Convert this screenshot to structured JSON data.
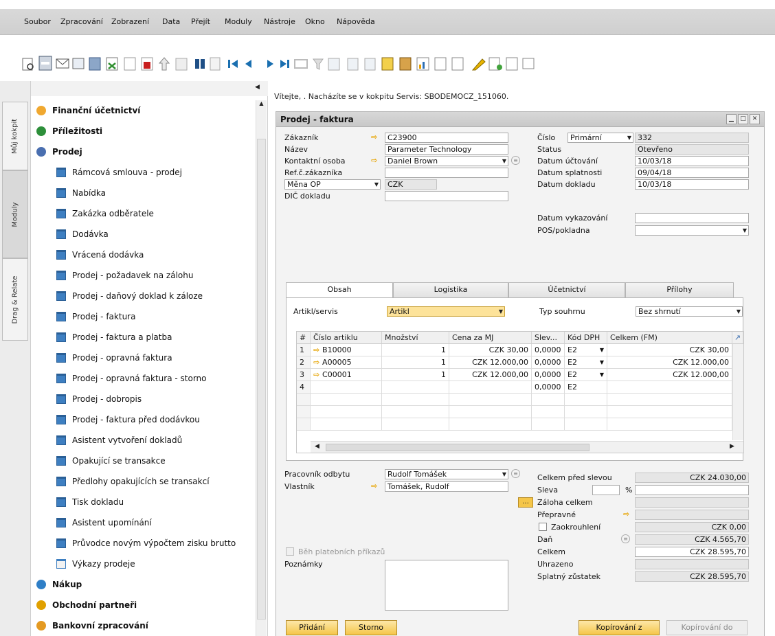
{
  "menu": [
    "Soubor",
    "Zpracování",
    "Zobrazení",
    "Data",
    "Přejít",
    "Moduly",
    "Nástroje",
    "Okno",
    "Nápověda"
  ],
  "side_tabs": [
    "Můj kokpit",
    "Moduly",
    "Drag & Relate"
  ],
  "modules": {
    "categories_top": [
      "Finanční účetnictví",
      "Příležitosti",
      "Prodej"
    ],
    "sales_items": [
      "Rámcová smlouva - prodej",
      "Nabídka",
      "Zakázka odběratele",
      "Dodávka",
      "Vrácená dodávka",
      "Prodej - požadavek na zálohu",
      "Prodej - daňový doklad k záloze",
      "Prodej - faktura",
      "Prodej - faktura a platba",
      "Prodej - opravná faktura",
      "Prodej - opravná faktura - storno",
      "Prodej - dobropis",
      "Prodej - faktura před dodávkou",
      "Asistent vytvoření dokladů",
      "Opakující se transakce",
      "Předlohy opakujících se transakcí",
      "Tisk dokladu",
      "Asistent upomínání",
      "Průvodce novým výpočtem zisku brutto",
      "Výkazy prodeje"
    ],
    "categories_bottom": [
      "Nákup",
      "Obchodní partneři",
      "Bankovní zpracování"
    ]
  },
  "welcome": "Vítejte, . Nacházíte se v kokpitu Servis: SBODEMOCZ_151060.",
  "form": {
    "title": "Prodej - faktura",
    "labels": {
      "customer": "Zákazník",
      "name": "Název",
      "contact": "Kontaktní osoba",
      "ref": "Ref.č.zákazníka",
      "currency": "Měna OP",
      "vat": "DIČ dokladu",
      "number": "Číslo",
      "status": "Status",
      "posting_date": "Datum účtování",
      "due_date": "Datum splatnosti",
      "doc_date": "Datum dokladu",
      "report_date": "Datum vykazování",
      "pos": "POS/pokladna"
    },
    "values": {
      "customer": "C23900",
      "name": "Parameter Technology",
      "contact": "Daniel Brown",
      "ref": "",
      "currency": "CZK",
      "vat": "",
      "series": "Primární",
      "number": "332",
      "status": "Otevřeno",
      "posting_date": "10/03/18",
      "due_date": "09/04/18",
      "doc_date": "10/03/18",
      "report_date": "",
      "pos": ""
    },
    "tabs": [
      "Obsah",
      "Logistika",
      "Účetnictví",
      "Přílohy"
    ],
    "item_type_label": "Artikl/servis",
    "item_type_value": "Artikl",
    "summary_label": "Typ souhrnu",
    "summary_value": "Bez shrnutí",
    "grid_headers": [
      "#",
      "Číslo artiklu",
      "Množství",
      "Cena za MJ",
      "Slev...",
      "Kód DPH",
      "Celkem (FM)"
    ],
    "rows": [
      {
        "n": "1",
        "item": "B10000",
        "qty": "1",
        "price": "CZK 30,00",
        "disc": "0,0000",
        "tax": "E2",
        "total": "CZK 30,00"
      },
      {
        "n": "2",
        "item": "A00005",
        "qty": "1",
        "price": "CZK 12.000,00",
        "disc": "0,0000",
        "tax": "E2",
        "total": "CZK 12.000,00"
      },
      {
        "n": "3",
        "item": "C00001",
        "qty": "1",
        "price": "CZK 12.000,00",
        "disc": "0,0000",
        "tax": "E2",
        "total": "CZK 12.000,00"
      },
      {
        "n": "4",
        "item": "",
        "qty": "",
        "price": "",
        "disc": "0,0000",
        "tax": "E2",
        "total": ""
      }
    ],
    "sales_employee_label": "Pracovník odbytu",
    "sales_employee": "Rudolf Tomášek",
    "owner_label": "Vlastník",
    "owner": "Tomášek, Rudolf",
    "payment_run_label": "Běh platebních příkazů",
    "remarks_label": "Poznámky",
    "totals": {
      "before_discount_label": "Celkem před slevou",
      "before_discount": "CZK 24.030,00",
      "discount_label": "Sleva",
      "discount_pct_sign": "%",
      "down_payment_label": "Záloha celkem",
      "freight_label": "Přepravné",
      "rounding_label": "Zaokrouhlení",
      "rounding": "CZK 0,00",
      "tax_label": "Daň",
      "tax": "CZK 4.565,70",
      "total_label": "Celkem",
      "total": "CZK 28.595,70",
      "paid_label": "Uhrazeno",
      "balance_label": "Splatný zůstatek",
      "balance": "CZK 28.595,70"
    },
    "buttons": {
      "add": "Přidání",
      "cancel": "Storno",
      "copy_from": "Kopírování z",
      "copy_to": "Kopírování do"
    }
  }
}
